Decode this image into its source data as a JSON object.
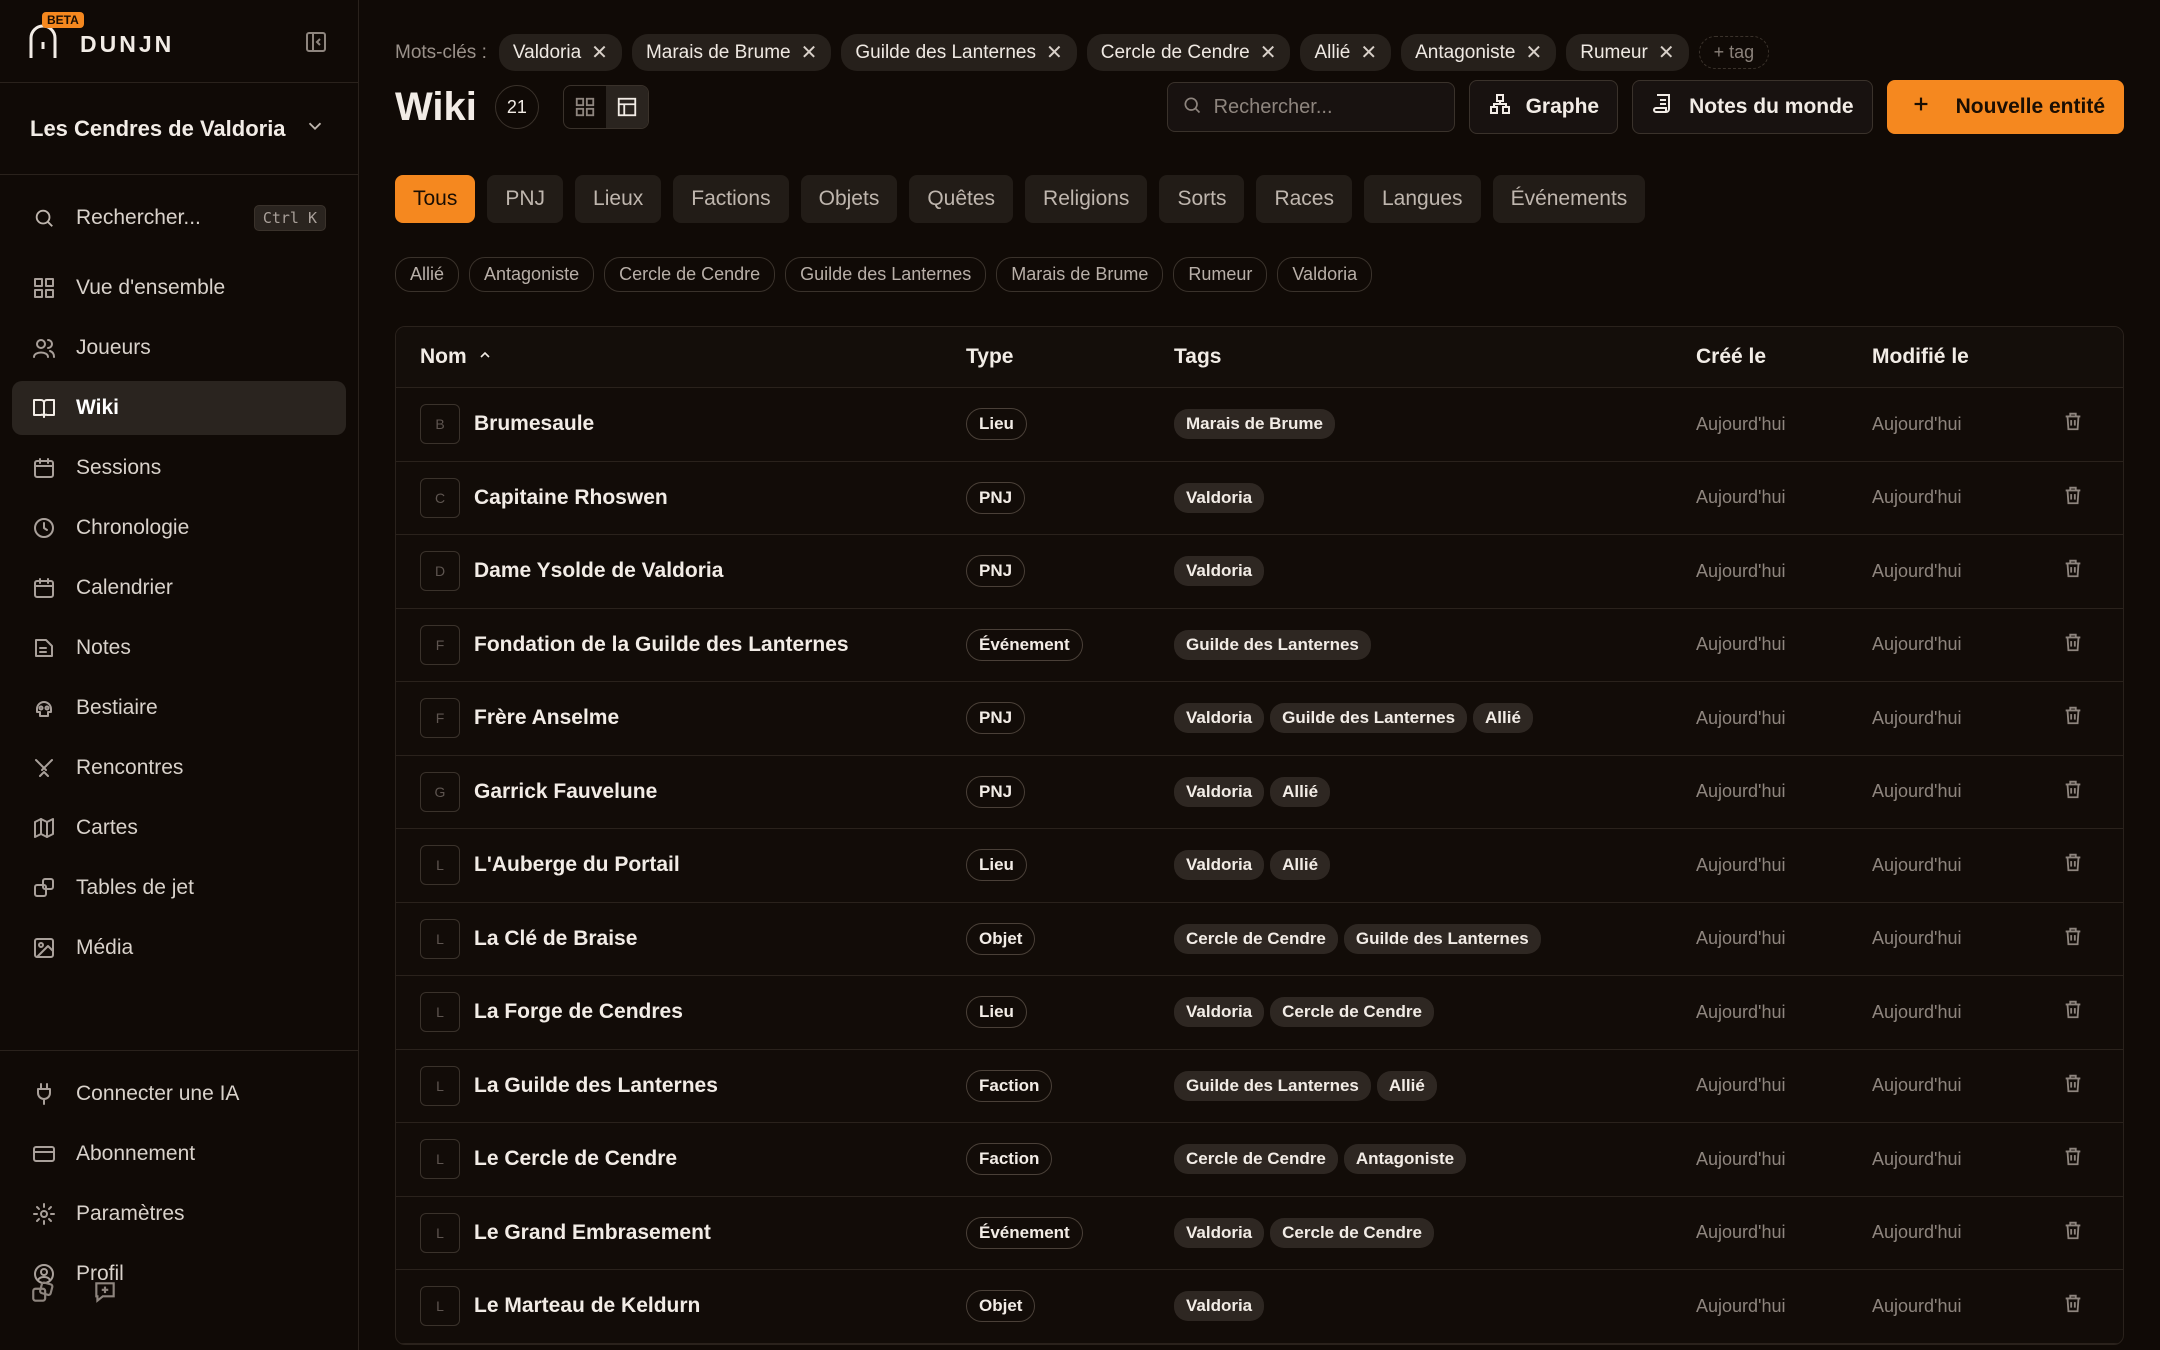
{
  "brand": {
    "name": "DUNJN",
    "badge": "BETA"
  },
  "world": {
    "name": "Les Cendres de Valdoria"
  },
  "sidebar": {
    "search": {
      "label": "Rechercher...",
      "shortcut": "Ctrl K"
    },
    "items": [
      {
        "label": "Vue d'ensemble",
        "icon": "grid-icon"
      },
      {
        "label": "Joueurs",
        "icon": "users-icon"
      },
      {
        "label": "Wiki",
        "icon": "book-icon"
      },
      {
        "label": "Sessions",
        "icon": "calendar-icon"
      },
      {
        "label": "Chronologie",
        "icon": "clock-icon"
      },
      {
        "label": "Calendrier",
        "icon": "calendar-icon"
      },
      {
        "label": "Notes",
        "icon": "note-icon"
      },
      {
        "label": "Bestiaire",
        "icon": "skull-icon"
      },
      {
        "label": "Rencontres",
        "icon": "swords-icon"
      },
      {
        "label": "Cartes",
        "icon": "map-icon"
      },
      {
        "label": "Tables de jet",
        "icon": "dice-icon"
      },
      {
        "label": "Média",
        "icon": "image-icon"
      }
    ],
    "bottom": [
      {
        "label": "Connecter une IA",
        "icon": "plug-icon"
      },
      {
        "label": "Abonnement",
        "icon": "card-icon"
      },
      {
        "label": "Paramètres",
        "icon": "gear-icon"
      },
      {
        "label": "Profil",
        "icon": "user-circle-icon"
      }
    ]
  },
  "keywords": {
    "label": "Mots-clés :",
    "items": [
      "Valdoria",
      "Marais de Brume",
      "Guilde des Lanternes",
      "Cercle de Cendre",
      "Allié",
      "Antagoniste",
      "Rumeur"
    ],
    "add_label": "+ tag"
  },
  "header": {
    "title": "Wiki",
    "count": "21",
    "search_placeholder": "Rechercher...",
    "graph_label": "Graphe",
    "notes_label": "Notes du monde",
    "new_label": "Nouvelle entité"
  },
  "categories": [
    "Tous",
    "PNJ",
    "Lieux",
    "Factions",
    "Objets",
    "Quêtes",
    "Religions",
    "Sorts",
    "Races",
    "Langues",
    "Événements"
  ],
  "tag_filters": [
    "Allié",
    "Antagoniste",
    "Cercle de Cendre",
    "Guilde des Lanternes",
    "Marais de Brume",
    "Rumeur",
    "Valdoria"
  ],
  "table": {
    "columns": {
      "name": "Nom",
      "type": "Type",
      "tags": "Tags",
      "created": "Créé le",
      "modified": "Modifié le"
    },
    "rows": [
      {
        "initial": "B",
        "name": "Brumesaule",
        "type": "Lieu",
        "tags": [
          "Marais de Brume"
        ],
        "created": "Aujourd'hui",
        "modified": "Aujourd'hui"
      },
      {
        "initial": "C",
        "name": "Capitaine Rhoswen",
        "type": "PNJ",
        "tags": [
          "Valdoria"
        ],
        "created": "Aujourd'hui",
        "modified": "Aujourd'hui"
      },
      {
        "initial": "D",
        "name": "Dame Ysolde de Valdoria",
        "type": "PNJ",
        "tags": [
          "Valdoria"
        ],
        "created": "Aujourd'hui",
        "modified": "Aujourd'hui"
      },
      {
        "initial": "F",
        "name": "Fondation de la Guilde des Lanternes",
        "type": "Événement",
        "tags": [
          "Guilde des Lanternes"
        ],
        "created": "Aujourd'hui",
        "modified": "Aujourd'hui"
      },
      {
        "initial": "F",
        "name": "Frère Anselme",
        "type": "PNJ",
        "tags": [
          "Valdoria",
          "Guilde des Lanternes",
          "Allié"
        ],
        "created": "Aujourd'hui",
        "modified": "Aujourd'hui"
      },
      {
        "initial": "G",
        "name": "Garrick Fauvelune",
        "type": "PNJ",
        "tags": [
          "Valdoria",
          "Allié"
        ],
        "created": "Aujourd'hui",
        "modified": "Aujourd'hui"
      },
      {
        "initial": "L",
        "name": "L'Auberge du Portail",
        "type": "Lieu",
        "tags": [
          "Valdoria",
          "Allié"
        ],
        "created": "Aujourd'hui",
        "modified": "Aujourd'hui"
      },
      {
        "initial": "L",
        "name": "La Clé de Braise",
        "type": "Objet",
        "tags": [
          "Cercle de Cendre",
          "Guilde des Lanternes"
        ],
        "created": "Aujourd'hui",
        "modified": "Aujourd'hui"
      },
      {
        "initial": "L",
        "name": "La Forge de Cendres",
        "type": "Lieu",
        "tags": [
          "Valdoria",
          "Cercle de Cendre"
        ],
        "created": "Aujourd'hui",
        "modified": "Aujourd'hui"
      },
      {
        "initial": "L",
        "name": "La Guilde des Lanternes",
        "type": "Faction",
        "tags": [
          "Guilde des Lanternes",
          "Allié"
        ],
        "created": "Aujourd'hui",
        "modified": "Aujourd'hui"
      },
      {
        "initial": "L",
        "name": "Le Cercle de Cendre",
        "type": "Faction",
        "tags": [
          "Cercle de Cendre",
          "Antagoniste"
        ],
        "created": "Aujourd'hui",
        "modified": "Aujourd'hui"
      },
      {
        "initial": "L",
        "name": "Le Grand Embrasement",
        "type": "Événement",
        "tags": [
          "Valdoria",
          "Cercle de Cendre"
        ],
        "created": "Aujourd'hui",
        "modified": "Aujourd'hui"
      },
      {
        "initial": "L",
        "name": "Le Marteau de Keldurn",
        "type": "Objet",
        "tags": [
          "Valdoria"
        ],
        "created": "Aujourd'hui",
        "modified": "Aujourd'hui"
      }
    ]
  },
  "colors": {
    "accent": "#f5881f",
    "background": "#100a06",
    "active_nav": "#2a241f"
  }
}
